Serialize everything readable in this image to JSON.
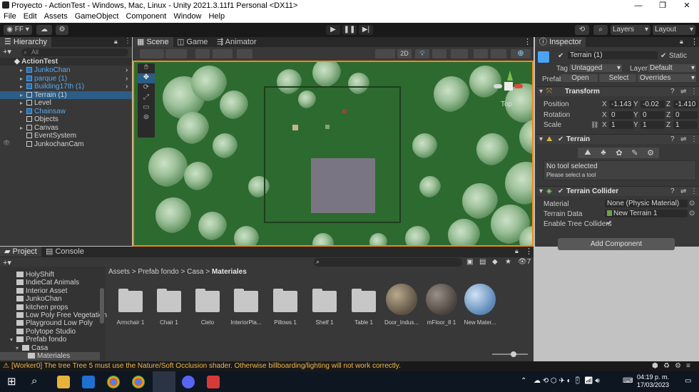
{
  "window": {
    "title": "Proyecto - ActionTest - Windows, Mac, Linux - Unity 2021.3.11f1 Personal <DX11>",
    "controls": [
      "—",
      "❐",
      "✕"
    ]
  },
  "menu": [
    "File",
    "Edit",
    "Assets",
    "GameObject",
    "Component",
    "Window",
    "Help"
  ],
  "toolbar": {
    "account": "FF",
    "layers": "Layers",
    "layout": "Layout"
  },
  "hierarchy": {
    "tab": "Hierarchy",
    "search_placeholder": "All",
    "scene": "ActionTest",
    "items": [
      {
        "label": "JunkoChan",
        "color": "blue",
        "expand": true
      },
      {
        "label": "parque (1)",
        "color": "blue",
        "expand": true
      },
      {
        "label": "Building17th (1)",
        "color": "blue",
        "expand": true
      },
      {
        "label": "Terrain (1)",
        "color": "white",
        "expand": true,
        "selected": true
      },
      {
        "label": "Level",
        "color": "white",
        "expand": true
      },
      {
        "label": "Chainsaw",
        "color": "blue",
        "expand": true
      },
      {
        "label": "Objects",
        "color": "white",
        "expand": false
      },
      {
        "label": "Canvas",
        "color": "white",
        "expand": true
      },
      {
        "label": "EventSystem",
        "color": "white",
        "expand": false
      },
      {
        "label": "JunkochanCam",
        "color": "white",
        "expand": false
      }
    ]
  },
  "scene": {
    "tabs": [
      "Scene",
      "Game",
      "Animator"
    ],
    "mode_2d": "2D",
    "gizmo_label": "Top"
  },
  "inspector": {
    "tab": "Inspector",
    "object_name": "Terrain (1)",
    "static_label": "Static",
    "tag_label": "Tag",
    "tag_value": "Untagged",
    "layer_label": "Layer",
    "layer_value": "Default",
    "prefab_label": "Prefab",
    "prefab_open": "Open",
    "prefab_select": "Select",
    "prefab_overrides": "Overrides",
    "transform": {
      "title": "Transform",
      "position_label": "Position",
      "rotation_label": "Rotation",
      "scale_label": "Scale",
      "position": {
        "x": "-1.143",
        "y": "-0.02",
        "z": "-1.410"
      },
      "rotation": {
        "x": "0",
        "y": "0",
        "z": "0"
      },
      "scale": {
        "x": "1",
        "y": "1",
        "z": "1"
      }
    },
    "terrain": {
      "title": "Terrain",
      "no_tool": "No tool selected",
      "hint": "Please select a tool"
    },
    "collider": {
      "title": "Terrain Collider",
      "material_label": "Material",
      "material_value": "None (Physic Material)",
      "data_label": "Terrain Data",
      "data_value": "New Terrain 1",
      "trees_label": "Enable Tree Colliders"
    },
    "add_component": "Add Component"
  },
  "project": {
    "tabs": [
      "Project",
      "Console"
    ],
    "folders": [
      {
        "label": "HolyShift",
        "indent": 1
      },
      {
        "label": "IndieCat Animals",
        "indent": 1
      },
      {
        "label": "Interior Asset",
        "indent": 1
      },
      {
        "label": "JunkoChan",
        "indent": 1
      },
      {
        "label": "kitchen props",
        "indent": 1
      },
      {
        "label": "Low Poly Free Vegetation",
        "indent": 1
      },
      {
        "label": "Playground Low Poly",
        "indent": 1
      },
      {
        "label": "Polytope Studio",
        "indent": 1
      },
      {
        "label": "Prefab fondo",
        "indent": 1
      },
      {
        "label": "Casa",
        "indent": 2
      },
      {
        "label": "Materiales",
        "indent": 3
      }
    ],
    "breadcrumb": [
      "Assets",
      "Prefab fondo",
      "Casa",
      "Materiales"
    ],
    "hidden_count": "7",
    "assets": [
      {
        "label": "Armchair 1",
        "kind": "folder"
      },
      {
        "label": "Chair 1",
        "kind": "folder"
      },
      {
        "label": "Cielo",
        "kind": "folder"
      },
      {
        "label": "InteriorPla...",
        "kind": "folder"
      },
      {
        "label": "Pillows 1",
        "kind": "folder"
      },
      {
        "label": "Shelf 1",
        "kind": "folder"
      },
      {
        "label": "Table 1",
        "kind": "folder"
      },
      {
        "label": "Door_Indus...",
        "kind": "material-brown"
      },
      {
        "label": "mFloor_8 1",
        "kind": "material-gray"
      },
      {
        "label": "New Mater...",
        "kind": "material-blue"
      }
    ]
  },
  "status": {
    "message": "[Worker0] The tree Tree 5 must use the Nature/Soft Occlusion shader. Otherwise billboarding/lighting will not work correctly."
  },
  "taskbar": {
    "time": "04:19 p. m.",
    "date": "17/03/2023"
  }
}
